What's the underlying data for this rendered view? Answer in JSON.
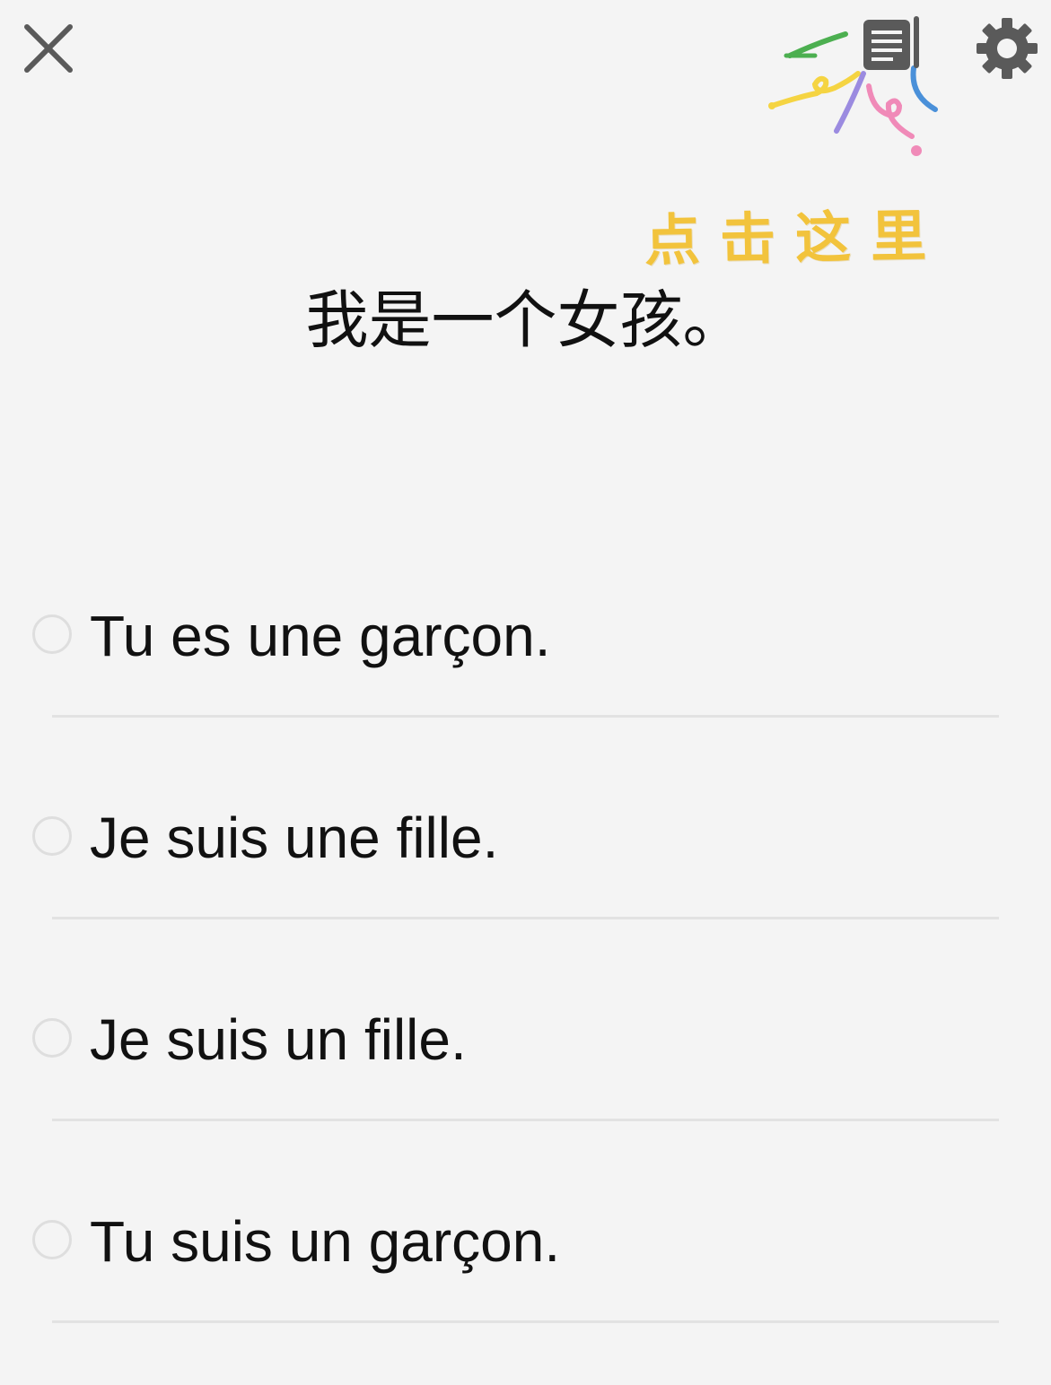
{
  "toolbar": {
    "close_icon": "close-x-icon",
    "notes_icon": "notes-icon",
    "settings_icon": "gear-icon",
    "icon_color": "#5a5a5a"
  },
  "hint": {
    "text": "点击这里",
    "color": "#f2c33c"
  },
  "question": {
    "prompt": "我是一个女孩。"
  },
  "options": [
    {
      "label": "Tu es une garçon."
    },
    {
      "label": "Je suis une fille."
    },
    {
      "label": "Je suis un fille."
    },
    {
      "label": "Tu suis un garçon."
    }
  ],
  "decoration": {
    "colors": [
      "#4caf50",
      "#f5d442",
      "#9b8be0",
      "#4a90d9",
      "#f08ab8"
    ]
  }
}
